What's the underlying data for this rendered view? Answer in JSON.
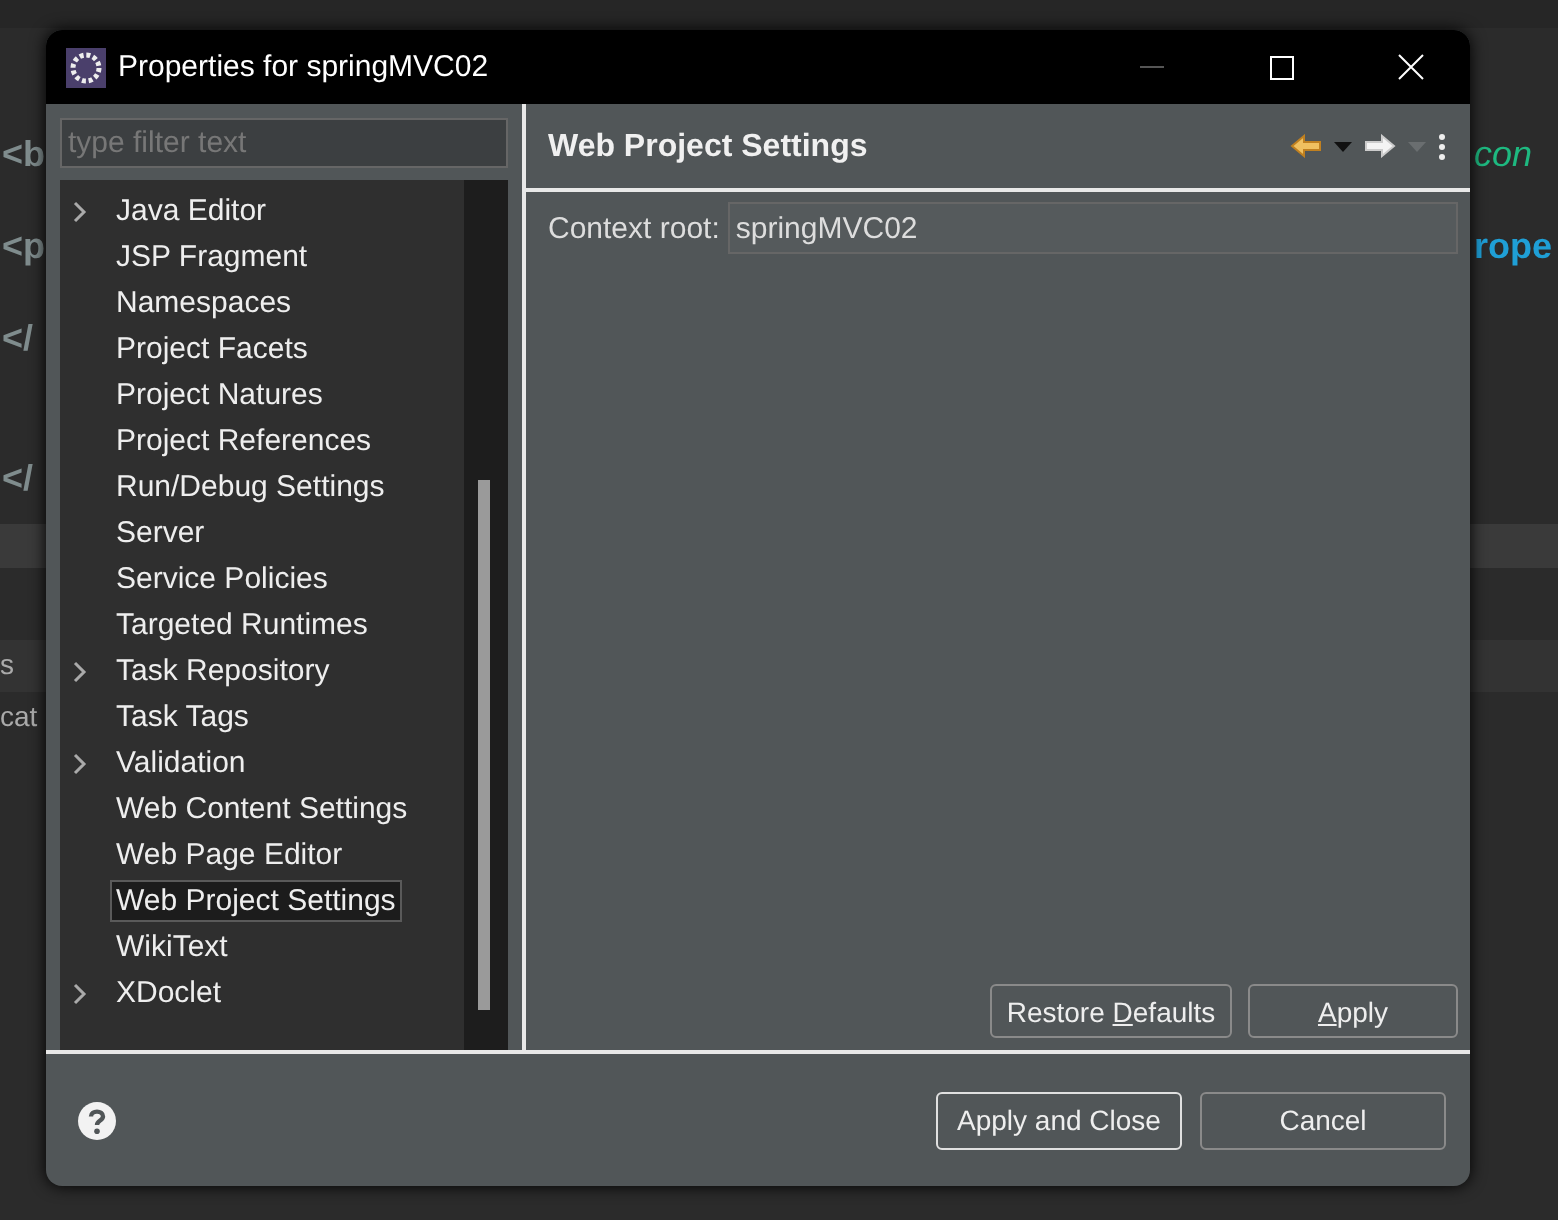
{
  "background": {
    "fragments": [
      {
        "text": "<b",
        "kind": "code"
      },
      {
        "text": "con",
        "kind": "attr"
      },
      {
        "text": "<p",
        "kind": "code"
      },
      {
        "text": "rope",
        "kind": "code"
      },
      {
        "text": "</",
        "kind": "code"
      },
      {
        "text": "</",
        "kind": "code"
      },
      {
        "text": "s",
        "kind": "tab"
      },
      {
        "text": "cat",
        "kind": "tab"
      }
    ]
  },
  "window": {
    "title": "Properties for springMVC02"
  },
  "filter": {
    "placeholder": "type filter text"
  },
  "tree": {
    "items": [
      {
        "label": "Java Editor",
        "expandable": true,
        "selected": false
      },
      {
        "label": "JSP Fragment",
        "expandable": false,
        "selected": false
      },
      {
        "label": "Namespaces",
        "expandable": false,
        "selected": false
      },
      {
        "label": "Project Facets",
        "expandable": false,
        "selected": false
      },
      {
        "label": "Project Natures",
        "expandable": false,
        "selected": false
      },
      {
        "label": "Project References",
        "expandable": false,
        "selected": false
      },
      {
        "label": "Run/Debug Settings",
        "expandable": false,
        "selected": false
      },
      {
        "label": "Server",
        "expandable": false,
        "selected": false
      },
      {
        "label": "Service Policies",
        "expandable": false,
        "selected": false
      },
      {
        "label": "Targeted Runtimes",
        "expandable": false,
        "selected": false
      },
      {
        "label": "Task Repository",
        "expandable": true,
        "selected": false
      },
      {
        "label": "Task Tags",
        "expandable": false,
        "selected": false
      },
      {
        "label": "Validation",
        "expandable": true,
        "selected": false
      },
      {
        "label": "Web Content Settings",
        "expandable": false,
        "selected": false
      },
      {
        "label": "Web Page Editor",
        "expandable": false,
        "selected": false
      },
      {
        "label": "Web Project Settings",
        "expandable": false,
        "selected": true
      },
      {
        "label": "WikiText",
        "expandable": false,
        "selected": false
      },
      {
        "label": "XDoclet",
        "expandable": true,
        "selected": false
      }
    ]
  },
  "page": {
    "title": "Web Project Settings",
    "fields": [
      {
        "label": "Context root:",
        "value": "springMVC02"
      }
    ],
    "buttons": [
      {
        "before": "Restore ",
        "mnemonic": "D",
        "after": "efaults"
      },
      {
        "mnemonic": "A",
        "after": "pply"
      }
    ]
  },
  "footer": {
    "buttons": [
      {
        "label": "Apply and Close",
        "kind": "default"
      },
      {
        "label": "Cancel",
        "kind": "normal"
      }
    ]
  }
}
